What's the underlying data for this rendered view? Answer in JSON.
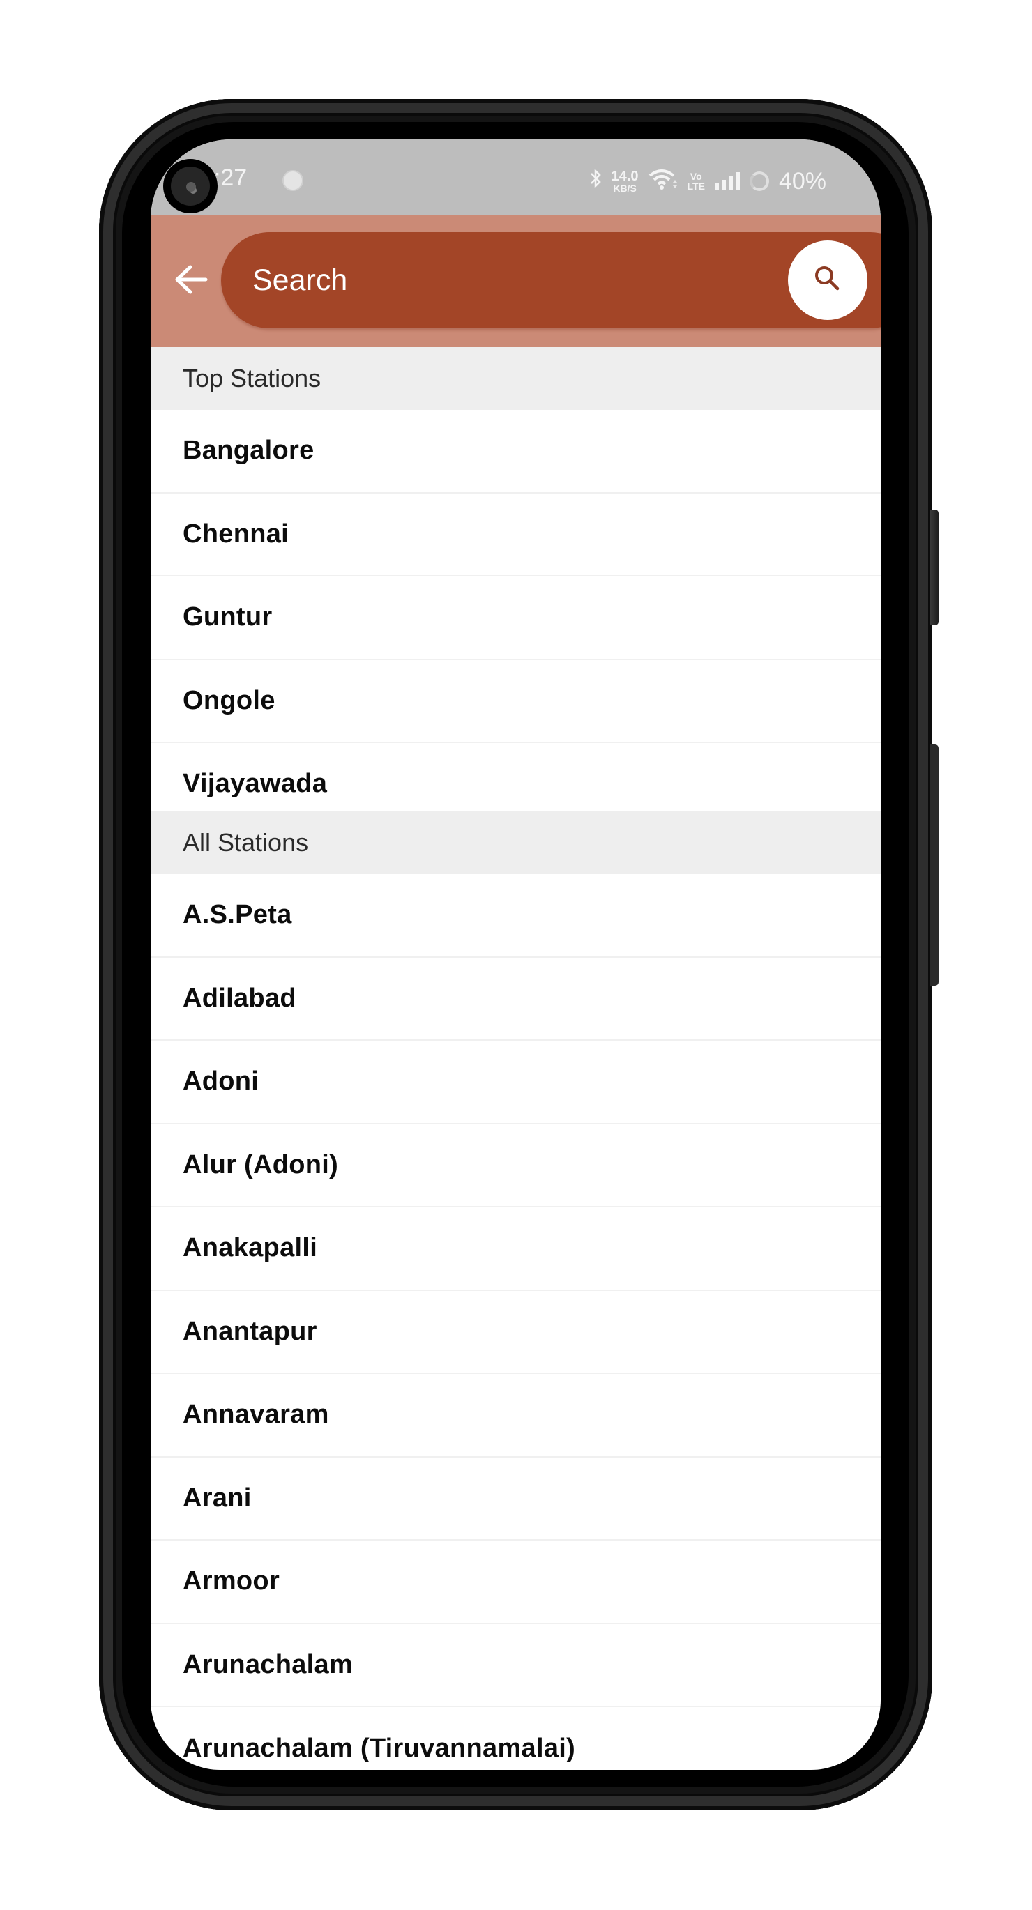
{
  "status_bar": {
    "time": "1:27",
    "network_speed_value": "14.0",
    "network_speed_unit": "KB/S",
    "volte_top": "Vo",
    "volte_bottom": "LTE",
    "battery_percent": "40%",
    "icons": [
      "notification-icon",
      "bluetooth-icon",
      "wifi-icon",
      "volte-icon",
      "signal-icon",
      "battery-icon"
    ]
  },
  "header": {
    "back_icon": "arrow-left",
    "search_placeholder": "Search",
    "search_value": "",
    "search_icon": "magnifier"
  },
  "sections": [
    {
      "title": "Top Stations",
      "items": [
        "Bangalore",
        "Chennai",
        "Guntur",
        "Ongole",
        "Vijayawada"
      ]
    },
    {
      "title": "All Stations",
      "items": [
        "A.S.Peta",
        "Adilabad",
        "Adoni",
        "Alur (Adoni)",
        "Anakapalli",
        "Anantapur",
        "Annavaram",
        "Arani",
        "Armoor",
        "Arunachalam",
        "Arunachalam (Tiruvannamalai)"
      ]
    }
  ],
  "colors": {
    "status_bar_bg": "#bdbdbd",
    "header_bg": "#cb8a76",
    "search_pill_bg": "#a34527",
    "section_header_bg": "#eeeeee",
    "search_icon_color": "#8b3a22"
  }
}
